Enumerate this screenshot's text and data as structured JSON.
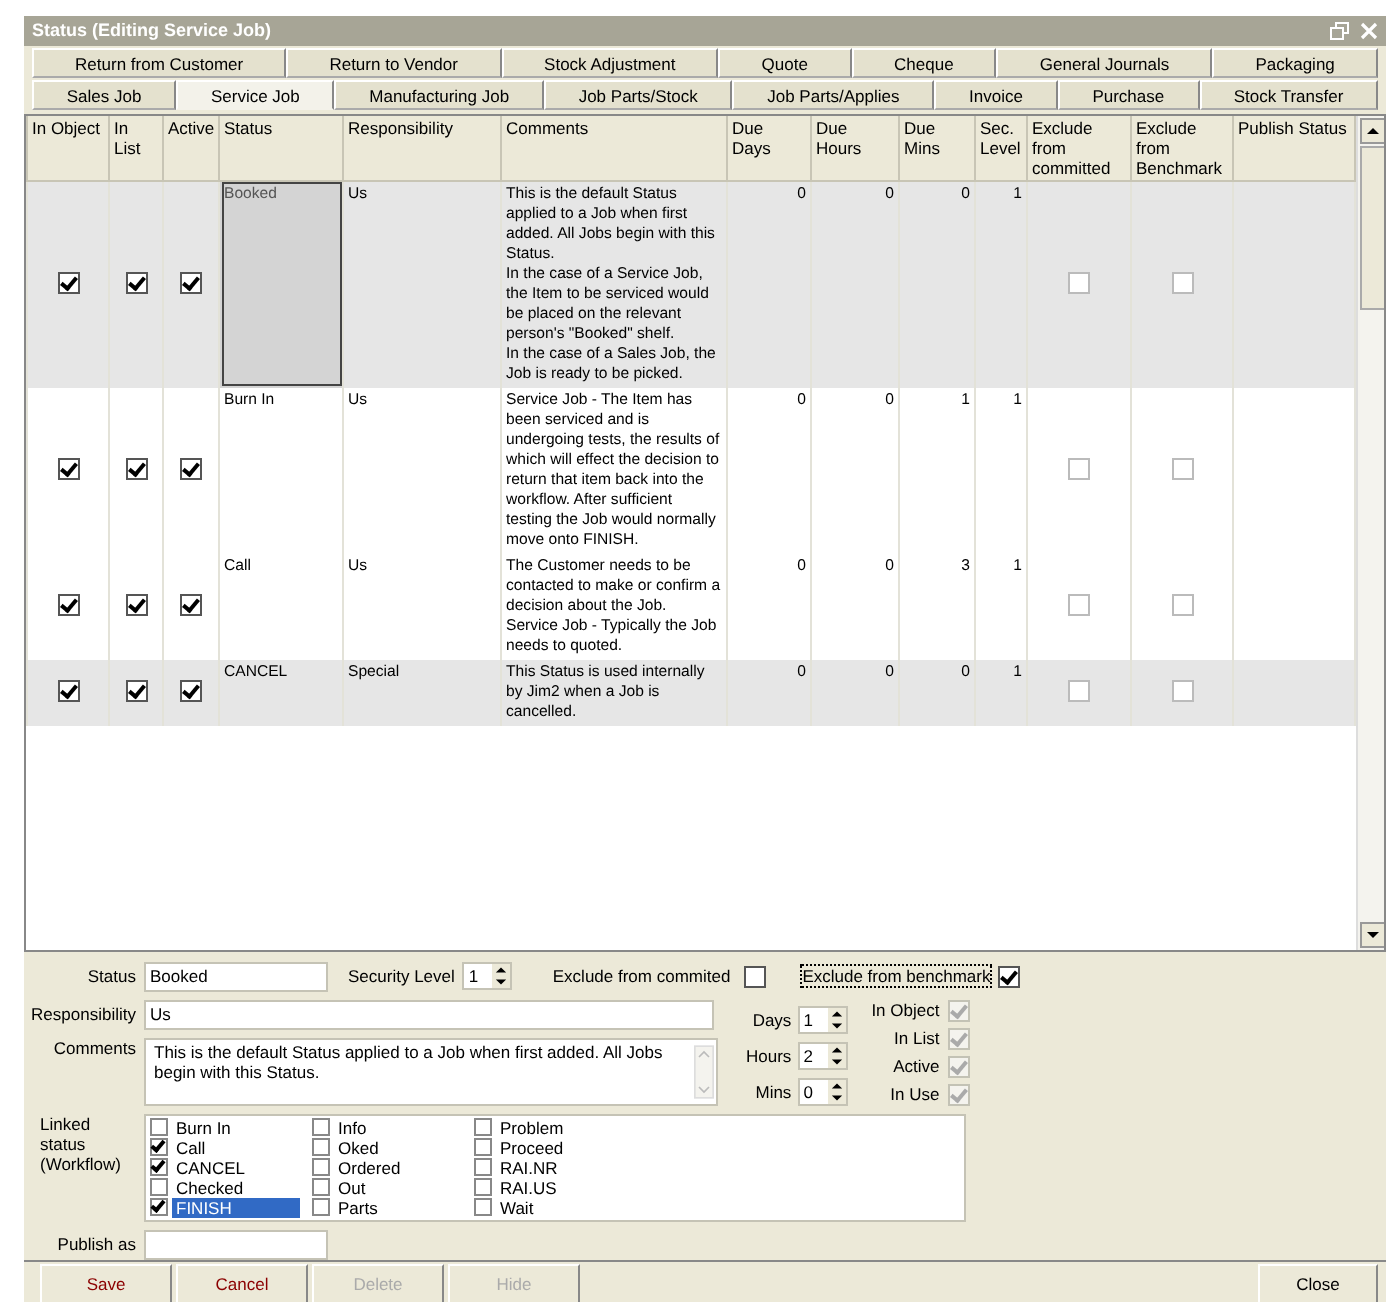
{
  "window": {
    "title": "Status (Editing Service Job)"
  },
  "tab_rows": [
    [
      {
        "label": "Return from Customer",
        "selected": false
      },
      {
        "label": "Return to Vendor",
        "selected": false
      },
      {
        "label": "Stock Adjustment",
        "selected": false
      },
      {
        "label": "Quote",
        "selected": false
      },
      {
        "label": "Cheque",
        "selected": false
      },
      {
        "label": "General Journals",
        "selected": false
      },
      {
        "label": "Packaging",
        "selected": false
      }
    ],
    [
      {
        "label": "Sales Job",
        "selected": false
      },
      {
        "label": "Service Job",
        "selected": true
      },
      {
        "label": "Manufacturing Job",
        "selected": false
      },
      {
        "label": "Job Parts/Stock",
        "selected": false
      },
      {
        "label": "Job Parts/Applies",
        "selected": false
      },
      {
        "label": "Invoice",
        "selected": false
      },
      {
        "label": "Purchase",
        "selected": false
      },
      {
        "label": "Stock Transfer",
        "selected": false
      }
    ]
  ],
  "table": {
    "columns": [
      "In Object",
      "In List",
      "Active",
      "Status",
      "Responsibility",
      "Comments",
      "Due Days",
      "Due Hours",
      "Due Mins",
      "Sec. Level",
      "Exclude from committed",
      "Exclude from Benchmark",
      "Publish Status"
    ],
    "rows": [
      {
        "selected": true,
        "focused": true,
        "in_object": true,
        "in_list": true,
        "active": true,
        "status": "Booked",
        "responsibility": "Us",
        "comments": "This is the default Status applied to a Job when first added. All Jobs begin with this Status.\nIn the case of a Service Job, the Item to be serviced would be placed on the relevant person's \"Booked\" shelf.\nIn the case of a Sales Job, the Job is ready to be picked.",
        "due_days": "0",
        "due_hours": "0",
        "due_mins": "0",
        "sec_level": "1",
        "exclude_committed": false,
        "exclude_benchmark": false
      },
      {
        "selected": false,
        "focused": false,
        "in_object": true,
        "in_list": true,
        "active": true,
        "status": "Burn In",
        "responsibility": "Us",
        "comments": "Service Job - The Item has been serviced and is undergoing tests, the results of which will effect the decision to return that item back into the workflow. After sufficient testing the Job would normally move onto FINISH.",
        "due_days": "0",
        "due_hours": "0",
        "due_mins": "1",
        "sec_level": "1",
        "exclude_committed": false,
        "exclude_benchmark": false
      },
      {
        "selected": false,
        "focused": false,
        "in_object": true,
        "in_list": true,
        "active": true,
        "status": "Call",
        "responsibility": "Us",
        "comments": "The Customer needs to be contacted to make or confirm a decision about the Job. Service Job - Typically the Job needs to quoted.",
        "due_days": "0",
        "due_hours": "0",
        "due_mins": "3",
        "sec_level": "1",
        "exclude_committed": false,
        "exclude_benchmark": false
      },
      {
        "selected": true,
        "focused": false,
        "in_object": true,
        "in_list": true,
        "active": true,
        "status": "CANCEL",
        "responsibility": "Special",
        "comments": "This Status is used internally by Jim2 when a Job is cancelled.",
        "due_days": "0",
        "due_hours": "0",
        "due_mins": "0",
        "sec_level": "1",
        "exclude_committed": false,
        "exclude_benchmark": false
      }
    ]
  },
  "form": {
    "status_label": "Status",
    "status": "Booked",
    "security_label": "Security Level",
    "security_level": "1",
    "exclude_committed_label": "Exclude from commited",
    "exclude_committed": false,
    "exclude_benchmark_label": "Exclude from benchmark",
    "exclude_benchmark": true,
    "responsibility_label": "Responsibility",
    "responsibility": "Us",
    "comments_label": "Comments",
    "comments": "This is the default Status applied to a Job when first added. All Jobs begin with this Status.",
    "durations": [
      {
        "label": "Days",
        "value": "1"
      },
      {
        "label": "Hours",
        "value": "2"
      },
      {
        "label": "Mins",
        "value": "0"
      }
    ],
    "flags": [
      {
        "label": "In Object",
        "checked": true,
        "disabled": true
      },
      {
        "label": "In List",
        "checked": true,
        "disabled": true
      },
      {
        "label": "Active",
        "checked": true,
        "disabled": true
      },
      {
        "label": "In Use",
        "checked": true,
        "disabled": true
      }
    ],
    "linked_label": "Linked status (Workflow)",
    "linked": [
      {
        "label": "Burn In",
        "checked": false,
        "selected": false
      },
      {
        "label": "Call",
        "checked": true,
        "selected": false
      },
      {
        "label": "CANCEL",
        "checked": true,
        "selected": false
      },
      {
        "label": "Checked",
        "checked": false,
        "selected": false
      },
      {
        "label": "FINISH",
        "checked": true,
        "selected": true
      },
      {
        "label": "Info",
        "checked": false,
        "selected": false
      },
      {
        "label": "Oked",
        "checked": false,
        "selected": false
      },
      {
        "label": "Ordered",
        "checked": false,
        "selected": false
      },
      {
        "label": "Out",
        "checked": false,
        "selected": false
      },
      {
        "label": "Parts",
        "checked": false,
        "selected": false
      },
      {
        "label": "Problem",
        "checked": false,
        "selected": false
      },
      {
        "label": "Proceed",
        "checked": false,
        "selected": false
      },
      {
        "label": "RAI.NR",
        "checked": false,
        "selected": false
      },
      {
        "label": "RAI.US",
        "checked": false,
        "selected": false
      },
      {
        "label": "Wait",
        "checked": false,
        "selected": false
      }
    ],
    "publish_label": "Publish as"
  },
  "buttons": [
    {
      "label": "Save",
      "disabled": false
    },
    {
      "label": "Cancel",
      "disabled": false
    },
    {
      "label": "Delete",
      "disabled": true
    },
    {
      "label": "Hide",
      "disabled": true
    },
    {
      "label": "Close",
      "disabled": false
    }
  ]
}
